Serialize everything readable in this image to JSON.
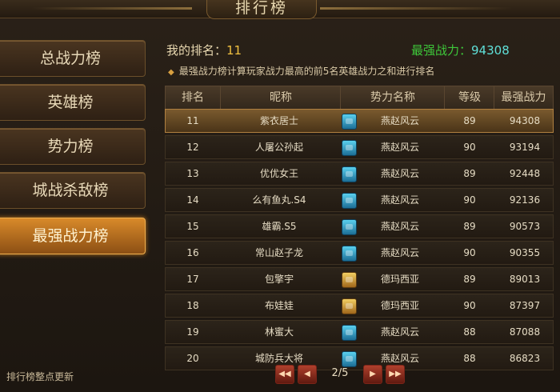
{
  "title": "排行榜",
  "sidebar": {
    "items": [
      {
        "label": "总战力榜"
      },
      {
        "label": "英雄榜"
      },
      {
        "label": "势力榜"
      },
      {
        "label": "城战杀敌榜"
      },
      {
        "label": "最强战力榜"
      }
    ],
    "active_index": 4
  },
  "footnote": "排行榜整点更新",
  "my_rank": {
    "label": "我的排名：",
    "value": "11"
  },
  "max_power": {
    "label": "最强战力：",
    "value": "94308"
  },
  "description": "最强战力榜计算玩家战力最高的前5名英雄战力之和进行排名",
  "table": {
    "headers": [
      "排名",
      "昵称",
      "势力名称",
      "等级",
      "最强战力"
    ],
    "rows": [
      {
        "rank": "11",
        "name": "紫衣居士",
        "faction_icon": "blue-faction-icon",
        "faction": "燕赵风云",
        "level": "89",
        "power": "94308"
      },
      {
        "rank": "12",
        "name": "人屠公孙起",
        "faction_icon": "blue-faction-icon",
        "faction": "燕赵风云",
        "level": "90",
        "power": "93194"
      },
      {
        "rank": "13",
        "name": "优优女王",
        "faction_icon": "blue-faction-icon",
        "faction": "燕赵风云",
        "level": "89",
        "power": "92448"
      },
      {
        "rank": "14",
        "name": "么有鱼丸.S4",
        "faction_icon": "blue-faction-icon",
        "faction": "燕赵风云",
        "level": "90",
        "power": "92136"
      },
      {
        "rank": "15",
        "name": "雄霸.S5",
        "faction_icon": "blue-faction-icon",
        "faction": "燕赵风云",
        "level": "89",
        "power": "90573"
      },
      {
        "rank": "16",
        "name": "常山赵子龙",
        "faction_icon": "blue-faction-icon",
        "faction": "燕赵风云",
        "level": "90",
        "power": "90355"
      },
      {
        "rank": "17",
        "name": "包擎宇",
        "faction_icon": "gold-faction-icon",
        "faction": "德玛西亚",
        "level": "89",
        "power": "89013"
      },
      {
        "rank": "18",
        "name": "布娃娃",
        "faction_icon": "gold-faction-icon",
        "faction": "德玛西亚",
        "level": "90",
        "power": "87397"
      },
      {
        "rank": "19",
        "name": "林蜜大",
        "faction_icon": "blue-faction-icon",
        "faction": "燕赵风云",
        "level": "88",
        "power": "87088"
      },
      {
        "rank": "20",
        "name": "城防兵大将",
        "faction_icon": "blue-faction-icon",
        "faction": "燕赵风云",
        "level": "88",
        "power": "86823"
      }
    ],
    "selected_index": 0
  },
  "pagination": {
    "first_icon": "double-left-arrow-icon",
    "prev_icon": "left-arrow-icon",
    "next_icon": "right-arrow-icon",
    "last_icon": "double-right-arrow-icon",
    "page_text": "2/5"
  }
}
